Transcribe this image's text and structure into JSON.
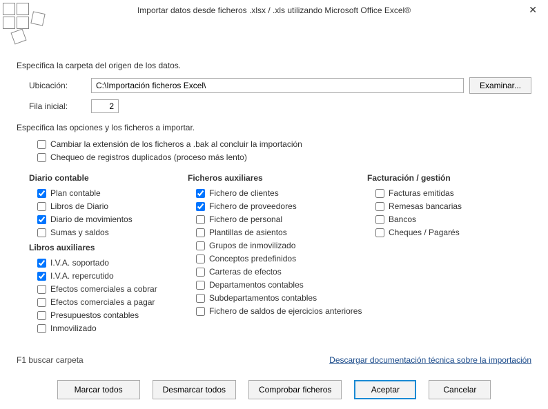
{
  "title": "Importar datos desde ficheros .xlsx / .xls utilizando Microsoft Office Excel®",
  "section_origin": "Especifica la carpeta del origen de los datos.",
  "location_label": "Ubicación:",
  "location_value": "C:\\Importación ficheros Excel\\",
  "browse_label": "Examinar...",
  "row_label": "Fila inicial:",
  "row_value": "2",
  "section_options": "Especifica las opciones y los ficheros a importar.",
  "opt_bak": {
    "label": "Cambiar la extensión de los ficheros a .bak al concluir la importación",
    "checked": false
  },
  "opt_dup": {
    "label": "Chequeo de registros duplicados (proceso más lento)",
    "checked": false
  },
  "columns": {
    "left": {
      "group1": {
        "title": "Diario contable",
        "items": [
          {
            "id": "plan-contable",
            "label": "Plan contable",
            "checked": true
          },
          {
            "id": "libros-diario",
            "label": "Libros de Diario",
            "checked": false
          },
          {
            "id": "diario-mov",
            "label": "Diario de movimientos",
            "checked": true
          },
          {
            "id": "sumas-saldos",
            "label": "Sumas y saldos",
            "checked": false
          }
        ]
      },
      "group2": {
        "title": "Libros auxiliares",
        "items": [
          {
            "id": "iva-sop",
            "label": "I.V.A. soportado",
            "checked": true
          },
          {
            "id": "iva-rep",
            "label": "I.V.A. repercutido",
            "checked": true
          },
          {
            "id": "ef-cobrar",
            "label": "Efectos comerciales a cobrar",
            "checked": false
          },
          {
            "id": "ef-pagar",
            "label": "Efectos comerciales a pagar",
            "checked": false
          },
          {
            "id": "presup",
            "label": "Presupuestos contables",
            "checked": false
          },
          {
            "id": "inmov",
            "label": "Inmovilizado",
            "checked": false
          }
        ]
      }
    },
    "mid": {
      "title": "Ficheros auxiliares",
      "items": [
        {
          "id": "f-cli",
          "label": "Fichero de clientes",
          "checked": true
        },
        {
          "id": "f-prov",
          "label": "Fichero de proveedores",
          "checked": true
        },
        {
          "id": "f-pers",
          "label": "Fichero de personal",
          "checked": false
        },
        {
          "id": "plantillas",
          "label": "Plantillas de asientos",
          "checked": false
        },
        {
          "id": "grupos-inm",
          "label": "Grupos de inmovilizado",
          "checked": false
        },
        {
          "id": "conceptos",
          "label": "Conceptos predefinidos",
          "checked": false
        },
        {
          "id": "carteras",
          "label": "Carteras de efectos",
          "checked": false
        },
        {
          "id": "deptos",
          "label": "Departamentos contables",
          "checked": false
        },
        {
          "id": "subdeptos",
          "label": "Subdepartamentos contables",
          "checked": false
        },
        {
          "id": "saldos-ant",
          "label": "Fichero de saldos de ejercicios anteriores",
          "checked": false
        }
      ]
    },
    "right": {
      "title": "Facturación / gestión",
      "items": [
        {
          "id": "fact-emit",
          "label": "Facturas emitidas",
          "checked": false
        },
        {
          "id": "remesas",
          "label": "Remesas bancarias",
          "checked": false
        },
        {
          "id": "bancos",
          "label": "Bancos",
          "checked": false
        },
        {
          "id": "cheques",
          "label": "Cheques / Pagarés",
          "checked": false
        }
      ]
    }
  },
  "hint": "F1 buscar carpeta",
  "link": "Descargar documentación técnica sobre la importación",
  "buttons": {
    "mark_all": "Marcar todos",
    "unmark_all": "Desmarcar todos",
    "check_files": "Comprobar ficheros",
    "accept": "Aceptar",
    "cancel": "Cancelar"
  }
}
